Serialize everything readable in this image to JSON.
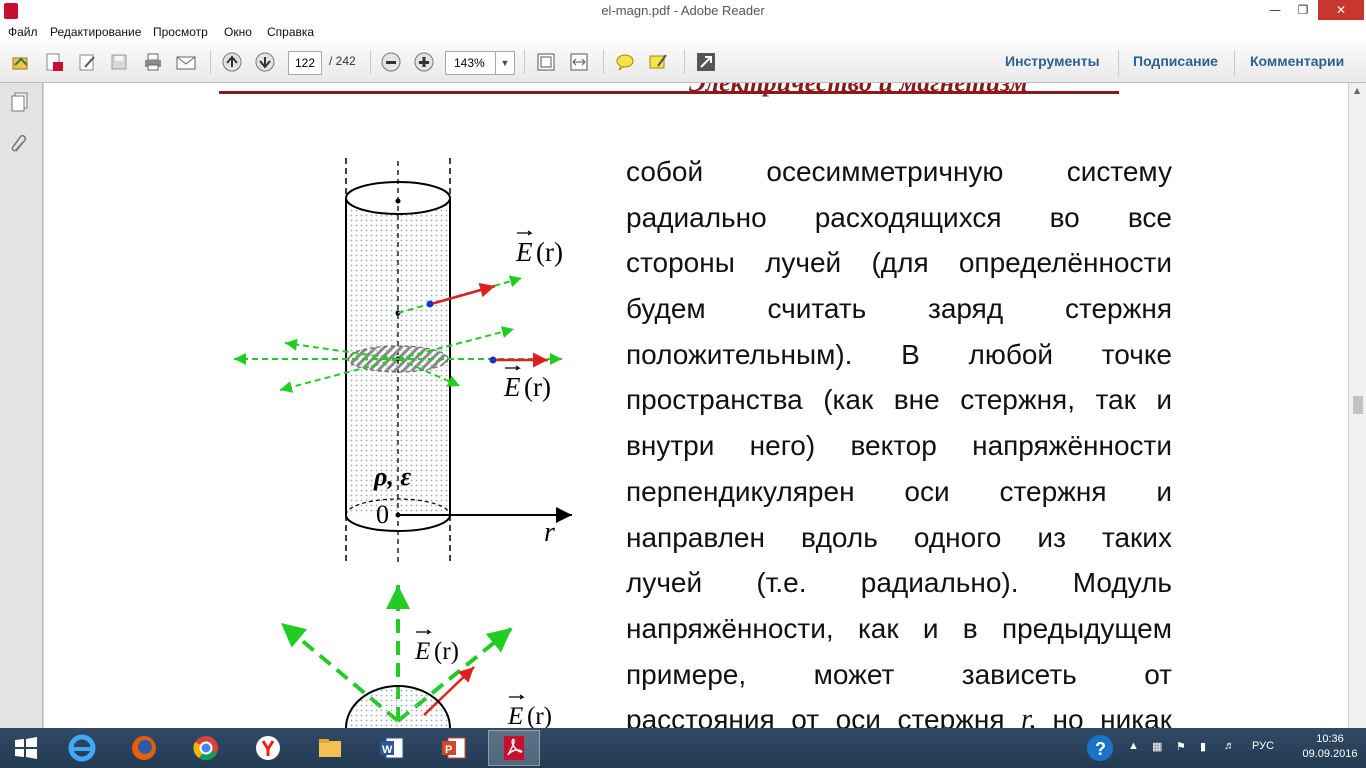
{
  "window": {
    "title": "el-magn.pdf - Adobe Reader"
  },
  "menu": [
    "Файл",
    "Редактирование",
    "Просмотр",
    "Окно",
    "Справка"
  ],
  "toolbar": {
    "page_current": "122",
    "page_total": "/ 242",
    "zoom": "143%"
  },
  "panels": {
    "tools": "Инструменты",
    "sign": "Подписание",
    "comments": "Комментарии"
  },
  "document": {
    "header": "Электричество и магнетизм",
    "paragraph_lines": [
      [
        "собой",
        "осесимметричную",
        "систему"
      ],
      [
        "радиально",
        "расходящихся",
        "во",
        "все"
      ],
      [
        "стороны",
        "лучей",
        "(для",
        "определённости"
      ],
      [
        "будем",
        "считать",
        "заряд",
        "стержня"
      ],
      [
        "положительным).",
        "В",
        "любой",
        "точке"
      ],
      [
        "пространства",
        "(как",
        "вне",
        "стержня,",
        "так",
        "и"
      ],
      [
        "внутри",
        "него)",
        "вектор",
        "напряжённости"
      ],
      [
        "перпендикулярен",
        "оси",
        "стержня",
        "и"
      ],
      [
        "направлен",
        "вдоль",
        "одного",
        "из",
        "таких"
      ],
      [
        "лучей",
        "(т.е.",
        "радиально).",
        "Модуль"
      ],
      [
        "напряжённости,",
        "как",
        "и",
        "в",
        "предыдущем"
      ],
      [
        "примере,",
        "может",
        "зависеть",
        "от"
      ],
      [
        "расстояния",
        "от",
        "оси",
        "стержня",
        "r,",
        "но",
        "никак"
      ]
    ],
    "figure": {
      "field_label": "E",
      "field_arg": "(r)",
      "density_label": "ρ, ε",
      "origin_label": "0",
      "axis_label": "r"
    }
  },
  "taskbar": {
    "language": "РУС",
    "time": "10:36",
    "date": "09.09.2016"
  }
}
